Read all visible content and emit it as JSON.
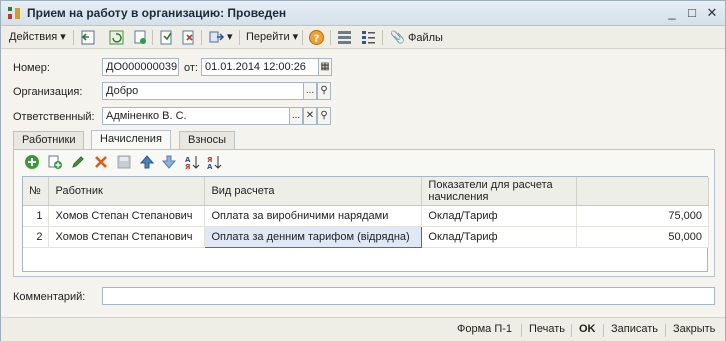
{
  "window": {
    "title": "Прием на работу в организацию: Проведен",
    "minimize": "_",
    "maximize": "□",
    "close": "✕"
  },
  "toolbar": {
    "actions_label": "Действия",
    "goto_label": "Перейти",
    "files_label": "Файлы"
  },
  "form": {
    "number_label": "Номер:",
    "number_value": "ДО000000039",
    "date_label": "от:",
    "date_value": "01.01.2014 12:00:26",
    "org_label": "Организация:",
    "org_value": "Добро",
    "resp_label": "Ответственный:",
    "resp_value": "Адміненко В. С.",
    "comment_label": "Комментарий:",
    "comment_value": ""
  },
  "tabs": [
    {
      "label": "Работники"
    },
    {
      "label": "Начисления"
    },
    {
      "label": "Взносы"
    }
  ],
  "grid": {
    "columns": [
      "№",
      "Работник",
      "Вид расчета",
      "Показатели для расчета начисления",
      ""
    ],
    "rows": [
      {
        "n": "1",
        "employee": "Хомов Степан Степанович",
        "calc": "Оплата за виробничими нарядами",
        "indicator": "Оклад/Тариф",
        "amount": "75,000"
      },
      {
        "n": "2",
        "employee": "Хомов Степан Степанович",
        "calc": "Оплата за денним тарифом (відрядна)",
        "indicator": "Оклад/Тариф",
        "amount": "50,000"
      }
    ]
  },
  "footer": {
    "form_label": "Форма П-1",
    "print_label": "Печать",
    "ok_label": "OK",
    "save_label": "Записать",
    "close_label": "Закрыть"
  },
  "colors": {
    "accent": "#3b6fc1",
    "selected_bg": "#dfe8f5"
  }
}
